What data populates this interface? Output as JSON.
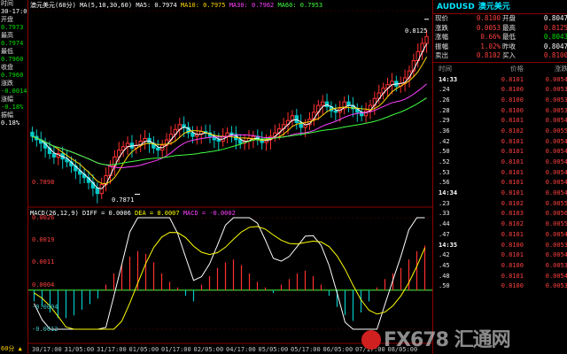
{
  "left_panel": {
    "rows": [
      {
        "text": "时间",
        "cls": "lp-label"
      },
      {
        "text": "30-17:00",
        "cls": "lp-white"
      },
      {
        "text": "开盘",
        "cls": "lp-label"
      },
      {
        "text": "0.7973",
        "cls": "lp-green"
      },
      {
        "text": "最高",
        "cls": "lp-label"
      },
      {
        "text": "0.7974",
        "cls": "lp-green"
      },
      {
        "text": "最低",
        "cls": "lp-label"
      },
      {
        "text": "0.7960",
        "cls": "lp-green"
      },
      {
        "text": "收盘",
        "cls": "lp-label"
      },
      {
        "text": "0.7960",
        "cls": "lp-green"
      },
      {
        "text": "涨跌",
        "cls": "lp-label"
      },
      {
        "text": "-0.0014",
        "cls": "lp-green"
      },
      {
        "text": "涨幅",
        "cls": "lp-label"
      },
      {
        "text": "-0.18%",
        "cls": "lp-green"
      },
      {
        "text": "振幅",
        "cls": "lp-label"
      },
      {
        "text": "0.18%",
        "cls": "lp-white"
      }
    ],
    "period": "60分 ▲"
  },
  "main_header": {
    "title": "澳元美元(60分)",
    "ma5": "MA5: 0.7974",
    "ma10": "MA10: 0.7975",
    "ma30": "MA30: 0.7962",
    "ma60": "MA60: 0.7953",
    "params": "MA(5,10,30,60)"
  },
  "macd_header": {
    "params": "MACD(26,12,9)",
    "diff": "DIFF = 0.0006",
    "dea": "DEA = 0.0007",
    "macd": "MACD = -0.0002"
  },
  "annotations": {
    "high": "0.8125",
    "low": "0.7871",
    "axis_label": "0.7898"
  },
  "macd_axis": [
    "0.0026",
    "0.0019",
    "0.0011",
    "0.0004",
    "-0.0004",
    "-0.0012"
  ],
  "time_axis": [
    "30/17:00",
    "31/05:00",
    "31/17:00",
    "01/05:00",
    "01/17:00",
    "02/05:00",
    "04/17:00",
    "05/05:00",
    "05/17:00",
    "06/05:00",
    "07/17:00",
    "08/05:00"
  ],
  "quote": {
    "symbol": "AUDUSD",
    "name": "澳元美元",
    "rows": [
      {
        "l1": "现价",
        "v1": "0.8100",
        "c1": "red",
        "l2": "开盘",
        "v2": "0.8047",
        "c2": "white"
      },
      {
        "l1": "涨跌",
        "v1": "0.0053",
        "c1": "red",
        "l2": "最高",
        "v2": "0.8125",
        "c2": "red"
      },
      {
        "l1": "涨幅",
        "v1": "0.66%",
        "c1": "red",
        "l2": "最低",
        "v2": "0.8043",
        "c2": "green"
      },
      {
        "l1": "振幅",
        "v1": "1.02%",
        "c1": "red",
        "l2": "昨收",
        "v2": "0.8047",
        "c2": "white"
      },
      {
        "l1": "卖出",
        "v1": "0.8102",
        "c1": "red",
        "l2": "买入",
        "v2": "0.8100",
        "c2": "red"
      }
    ],
    "ticks_header": [
      "时间",
      "价格",
      "涨跌"
    ],
    "ticks": [
      {
        "t": "14:33",
        "p": "0.8101",
        "c": "0.0054",
        "hl": true
      },
      {
        "t": ".24",
        "p": "0.8100",
        "c": "0.0053",
        "hl": false
      },
      {
        "t": ".26",
        "p": "0.8100",
        "c": "0.0053",
        "hl": false
      },
      {
        "t": ".28",
        "p": "0.8100",
        "c": "0.0053",
        "hl": false
      },
      {
        "t": ".29",
        "p": "0.8101",
        "c": "0.0054",
        "hl": false
      },
      {
        "t": ".36",
        "p": "0.8102",
        "c": "0.0055",
        "hl": false
      },
      {
        "t": ".42",
        "p": "0.8101",
        "c": "0.0054",
        "hl": false
      },
      {
        "t": ".50",
        "p": "0.8101",
        "c": "0.0054",
        "hl": false
      },
      {
        "t": ".52",
        "p": "0.8101",
        "c": "0.0054",
        "hl": false
      },
      {
        "t": ".53",
        "p": "0.8101",
        "c": "0.0054",
        "hl": false
      },
      {
        "t": ".56",
        "p": "0.8101",
        "c": "0.0054",
        "hl": false
      },
      {
        "t": "14:34",
        "p": "0.8101",
        "c": "0.0054",
        "hl": true
      },
      {
        "t": ".23",
        "p": "0.8102",
        "c": "0.0055",
        "hl": false
      },
      {
        "t": ".33",
        "p": "0.8103",
        "c": "0.0056",
        "hl": false
      },
      {
        "t": ".44",
        "p": "0.8102",
        "c": "0.0055",
        "hl": false
      },
      {
        "t": ".47",
        "p": "0.8101",
        "c": "0.0054",
        "hl": false
      },
      {
        "t": "14:35",
        "p": "0.8100",
        "c": "0.0053",
        "hl": true
      },
      {
        "t": ".42",
        "p": "0.8101",
        "c": "0.0054",
        "hl": false
      },
      {
        "t": ".45",
        "p": "0.8100",
        "c": "0.0053",
        "hl": false
      },
      {
        "t": ".48",
        "p": "0.8101",
        "c": "0.0054",
        "hl": false
      },
      {
        "t": ".50",
        "p": "0.8100",
        "c": "0.0053",
        "hl": false
      }
    ]
  },
  "watermark": "FX678 汇通网",
  "chart_data": {
    "type": "candlestick",
    "close": [
      0.7955,
      0.795,
      0.7945,
      0.7938,
      0.793,
      0.7925,
      0.793,
      0.7922,
      0.7918,
      0.7912,
      0.7905,
      0.79,
      0.7895,
      0.7888,
      0.788,
      0.7872,
      0.7885,
      0.7898,
      0.7912,
      0.7925,
      0.7935,
      0.794,
      0.7945,
      0.7938,
      0.7942,
      0.7948,
      0.7952,
      0.7945,
      0.7938,
      0.7935,
      0.7942,
      0.795,
      0.7958,
      0.7965,
      0.7972,
      0.7968,
      0.796,
      0.7955,
      0.7958,
      0.7962,
      0.796,
      0.7955,
      0.795,
      0.7948,
      0.7955,
      0.796,
      0.7958,
      0.795,
      0.7945,
      0.7948,
      0.7952,
      0.7955,
      0.795,
      0.7946,
      0.795,
      0.7955,
      0.796,
      0.7966,
      0.7972,
      0.7978,
      0.7985,
      0.7975,
      0.7968,
      0.7972,
      0.798,
      0.799,
      0.8,
      0.8005,
      0.7998,
      0.7992,
      0.799,
      0.7995,
      0.8005,
      0.8,
      0.7995,
      0.799,
      0.7985,
      0.7992,
      0.8,
      0.801,
      0.8018,
      0.8025,
      0.803,
      0.8035,
      0.8028,
      0.8032,
      0.804,
      0.805,
      0.8065,
      0.8078,
      0.809,
      0.81
    ],
    "macd_histogram": [
      -0.0004,
      -0.0006,
      -0.0008,
      -0.001,
      -0.001,
      -0.0009,
      -0.0007,
      -0.0005,
      -0.0003,
      0.0002,
      0.0006,
      0.0009,
      0.0012,
      0.0014,
      0.0013,
      0.001,
      0.0006,
      0.0003,
      0.0001,
      -0.0002,
      -0.0004,
      0.0002,
      0.0005,
      0.0008,
      0.001,
      0.0011,
      0.0009,
      0.0006,
      0.0003,
      0.0001,
      -0.0001,
      0.0002,
      0.0004,
      0.0006,
      0.0007,
      0.0005,
      0.0002,
      -0.0002,
      -0.0006,
      -0.0009,
      -0.0011,
      -0.0008,
      -0.0004,
      0.0001,
      0.0004,
      0.0006,
      0.0008,
      0.0011,
      0.0014,
      0.0016
    ],
    "ma_series": [
      "MA5",
      "MA10",
      "MA30",
      "MA60"
    ],
    "colors": {
      "up": "#ff3030",
      "down": "#00c8c8",
      "ma5": "#ffffff",
      "ma10": "#ffd700",
      "ma30": "#ff40ff",
      "ma60": "#40ff40"
    }
  }
}
